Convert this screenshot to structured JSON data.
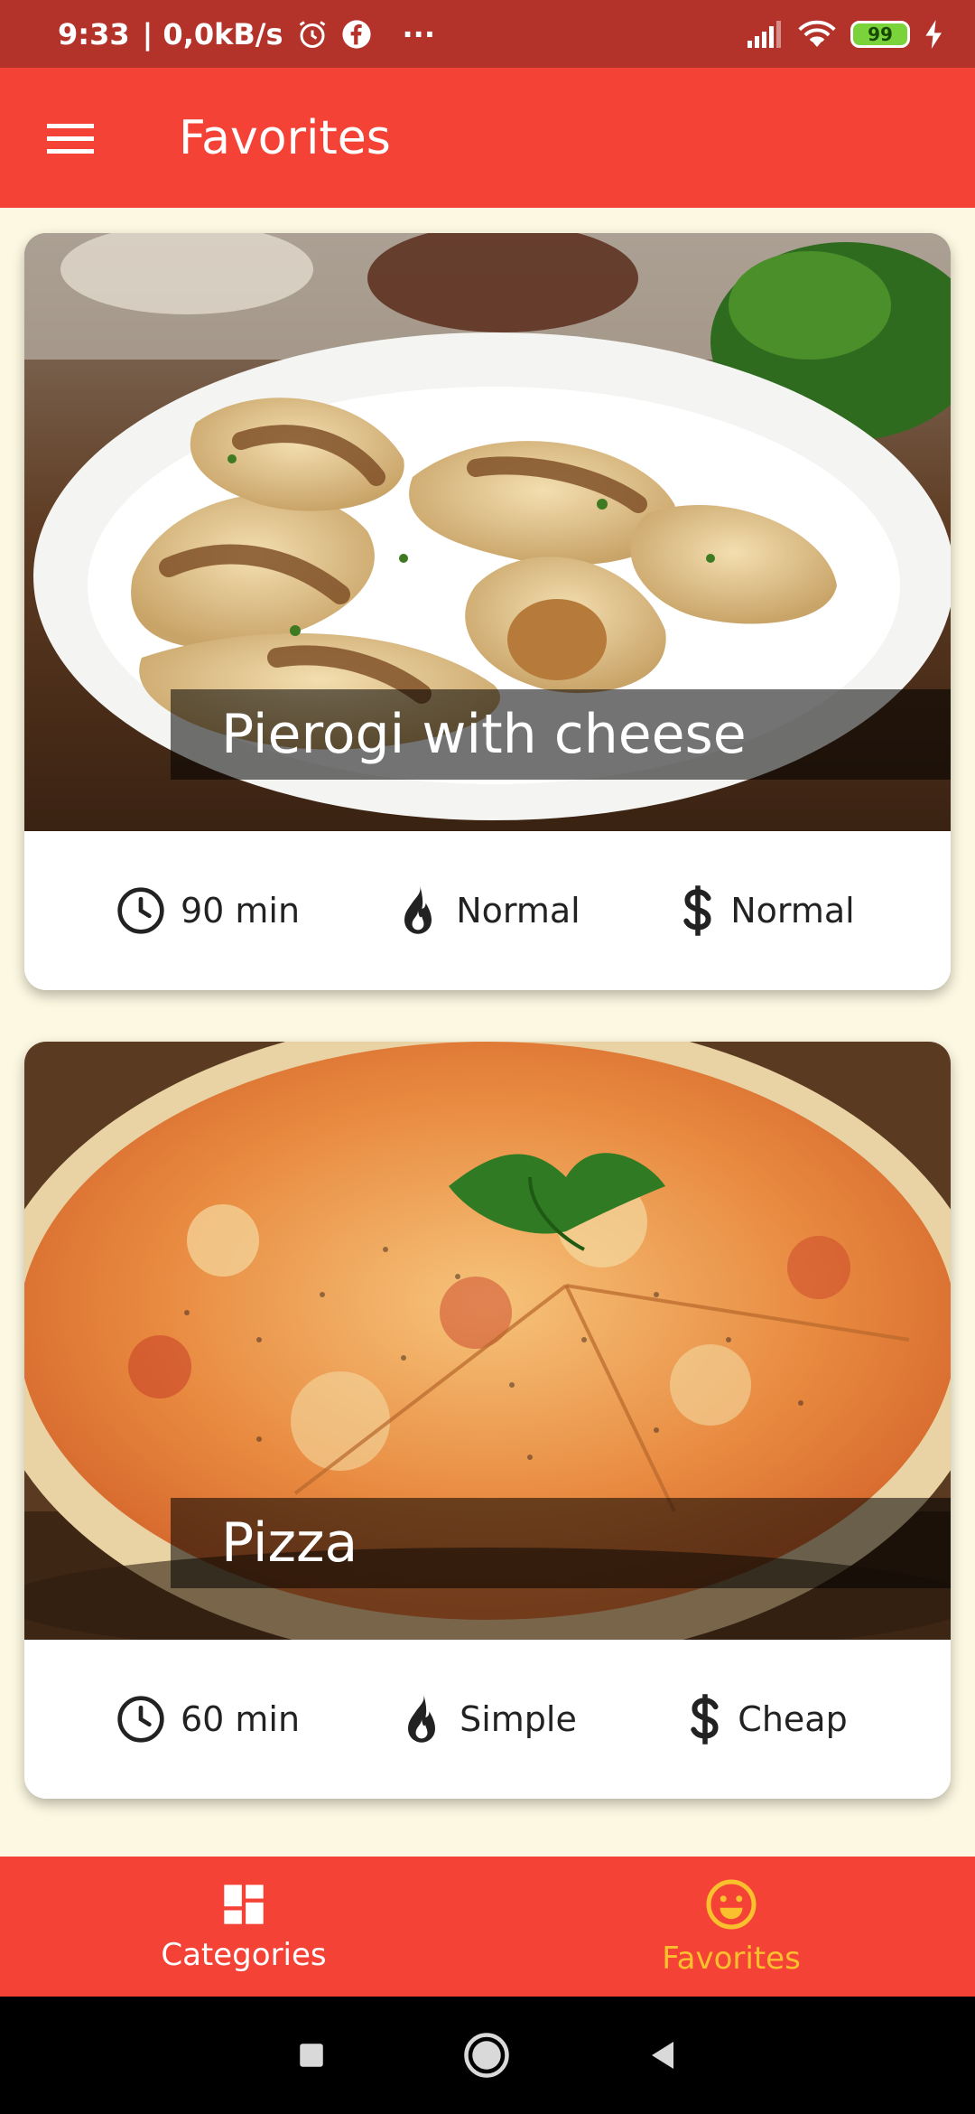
{
  "status_bar": {
    "time": "9:33",
    "speed": "| 0,0kB/s",
    "more": "···",
    "battery": "99"
  },
  "app_bar": {
    "title": "Favorites"
  },
  "meals": [
    {
      "title": "Pierogi with cheese",
      "duration": "90 min",
      "complexity": "Normal",
      "affordability": "Normal"
    },
    {
      "title": "Pizza",
      "duration": "60 min",
      "complexity": "Simple",
      "affordability": "Cheap"
    }
  ],
  "bottom_nav": {
    "categories": "Categories",
    "favorites": "Favorites",
    "active_color": "#fbc02d"
  },
  "icons": {
    "menu": "menu-icon",
    "clock": "clock-icon",
    "fire": "fire-icon",
    "dollar": "dollar-icon",
    "dashboard": "dashboard-icon",
    "smile": "smile-icon"
  }
}
